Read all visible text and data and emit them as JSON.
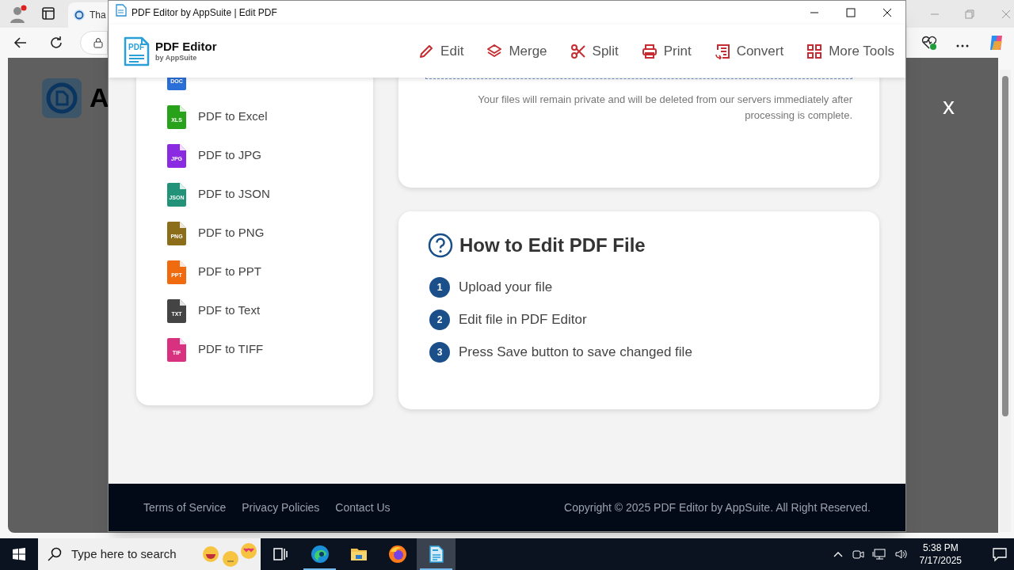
{
  "browser": {
    "tab_title": "Tha",
    "overlay_logo_letter": "A",
    "overlay_close": "x"
  },
  "window": {
    "title": "PDF Editor by AppSuite | Edit PDF"
  },
  "app": {
    "logo": {
      "icon_text": "PDF",
      "name": "PDF Editor",
      "tagline": "by AppSuite"
    },
    "nav": [
      {
        "kind": "pencil",
        "label": "Edit"
      },
      {
        "kind": "layers",
        "label": "Merge"
      },
      {
        "kind": "scissors",
        "label": "Split"
      },
      {
        "kind": "printer",
        "label": "Print"
      },
      {
        "kind": "convert",
        "label": "Convert"
      },
      {
        "kind": "grid",
        "label": "More Tools"
      }
    ]
  },
  "converters": [
    {
      "badge": "DOC",
      "color": "#2a6fd8"
    },
    {
      "label": "PDF to Excel",
      "badge": "XLS",
      "color": "#28a21a"
    },
    {
      "label": "PDF to JPG",
      "badge": "JPG",
      "color": "#8a2be2"
    },
    {
      "label": "PDF to JSON",
      "badge": "JSON",
      "color": "#229378"
    },
    {
      "label": "PDF to PNG",
      "badge": "PNG",
      "color": "#8c6d1a"
    },
    {
      "label": "PDF to PPT",
      "badge": "PPT",
      "color": "#f06a10"
    },
    {
      "label": "PDF to Text",
      "badge": "TXT",
      "color": "#444444"
    },
    {
      "label": "PDF to TIFF",
      "badge": "TIF",
      "color": "#d8317f"
    }
  ],
  "privacy_note": "Your files will remain private and will be deleted from our servers immediately after processing is complete.",
  "howto": {
    "title": "How to Edit PDF File",
    "steps": [
      {
        "number": "1",
        "text": "Upload your file"
      },
      {
        "number": "2",
        "text": "Edit file in PDF Editor"
      },
      {
        "number": "3",
        "text": "Press Save button to save changed file"
      }
    ]
  },
  "footer": {
    "links": [
      "Terms of Service",
      "Privacy Policies",
      "Contact Us"
    ],
    "copyright": "Copyright © 2025 PDF Editor by AppSuite. All Right Reserved."
  },
  "taskbar": {
    "search_placeholder": "Type here to search",
    "apps": [
      {
        "kind": "taskview",
        "running": false,
        "selected": false
      },
      {
        "kind": "edge",
        "running": true,
        "selected": false
      },
      {
        "kind": "folder",
        "running": false,
        "selected": false
      },
      {
        "kind": "firefox",
        "running": false,
        "selected": false
      },
      {
        "kind": "pdf",
        "running": true,
        "selected": true
      }
    ],
    "time": "5:38 PM",
    "date": "7/17/2025"
  }
}
